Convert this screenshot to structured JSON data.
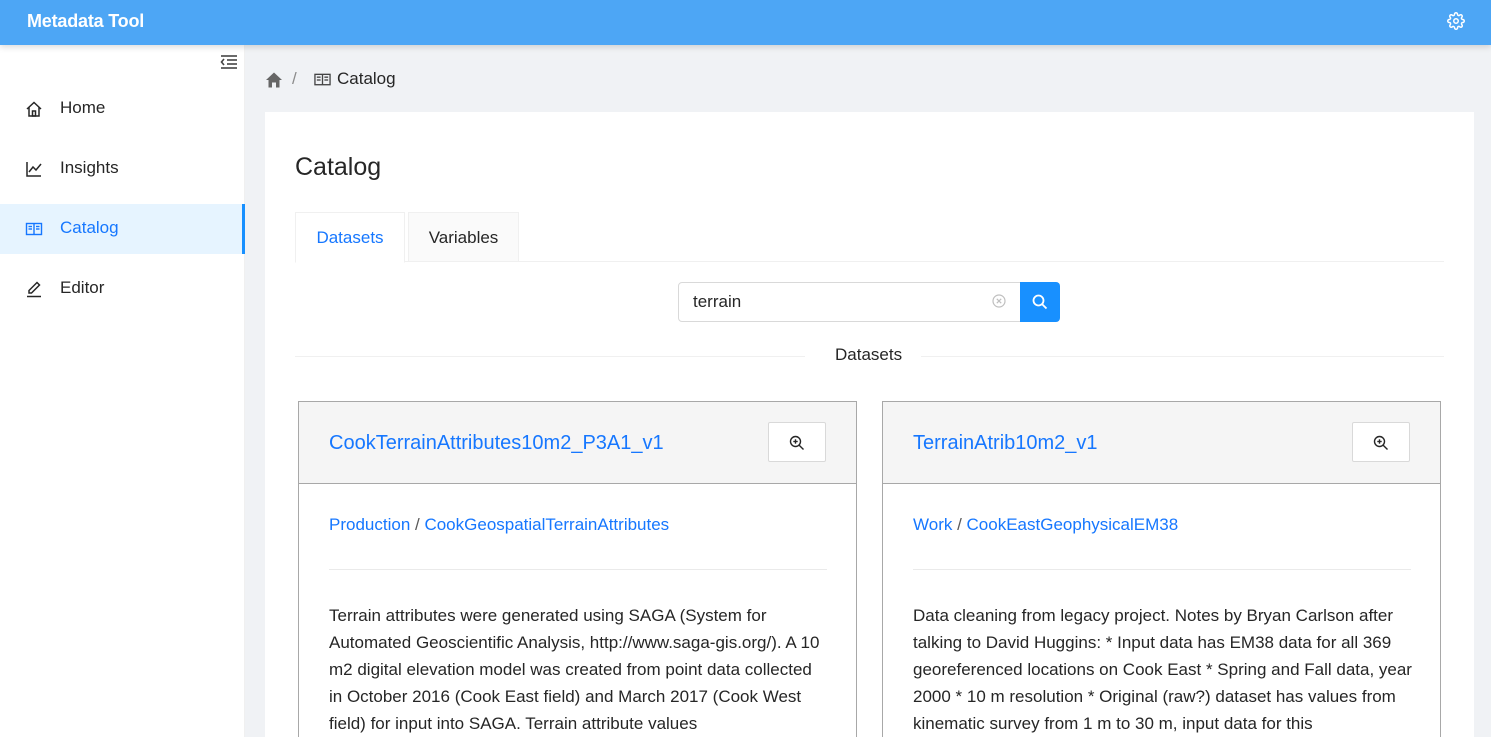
{
  "app": {
    "title": "Metadata Tool"
  },
  "sidebar": {
    "items": [
      {
        "label": "Home",
        "icon": "home-icon"
      },
      {
        "label": "Insights",
        "icon": "line-chart-icon"
      },
      {
        "label": "Catalog",
        "icon": "book-icon",
        "active": true
      },
      {
        "label": "Editor",
        "icon": "edit-icon"
      }
    ]
  },
  "breadcrumb": {
    "separator": "/",
    "current": "Catalog"
  },
  "page": {
    "title": "Catalog"
  },
  "tabs": [
    {
      "label": "Datasets",
      "active": true
    },
    {
      "label": "Variables",
      "active": false
    }
  ],
  "search": {
    "value": "terrain"
  },
  "divider_label": "Datasets",
  "cards": [
    {
      "title": "CookTerrainAttributes10m2_P3A1_v1",
      "path": [
        "Production",
        "CookGeospatialTerrainAttributes"
      ],
      "separator": " / ",
      "description": "Terrain attributes were generated using SAGA (System for Automated Geoscientific Analysis, http://www.saga-gis.org/). A 10 m2 digital elevation model was created from point data collected in October 2016 (Cook East field) and March 2017 (Cook West field) for input into SAGA. Terrain attribute values"
    },
    {
      "title": "TerrainAtrib10m2_v1",
      "path": [
        "Work",
        "CookEastGeophysicalEM38"
      ],
      "separator": " / ",
      "description": "Data cleaning from legacy project. Notes by Bryan Carlson after talking to David Huggins: * Input data has EM38 data for all 369 georeferenced locations on Cook East * Spring and Fall data, year 2000 * 10 m resolution * Original (raw?) dataset has values from kinematic survey from 1 m to 30 m, input data for this"
    }
  ],
  "colors": {
    "topbar": "#4da6f5",
    "accent": "#1677ff",
    "active_bg": "#e6f4ff"
  }
}
